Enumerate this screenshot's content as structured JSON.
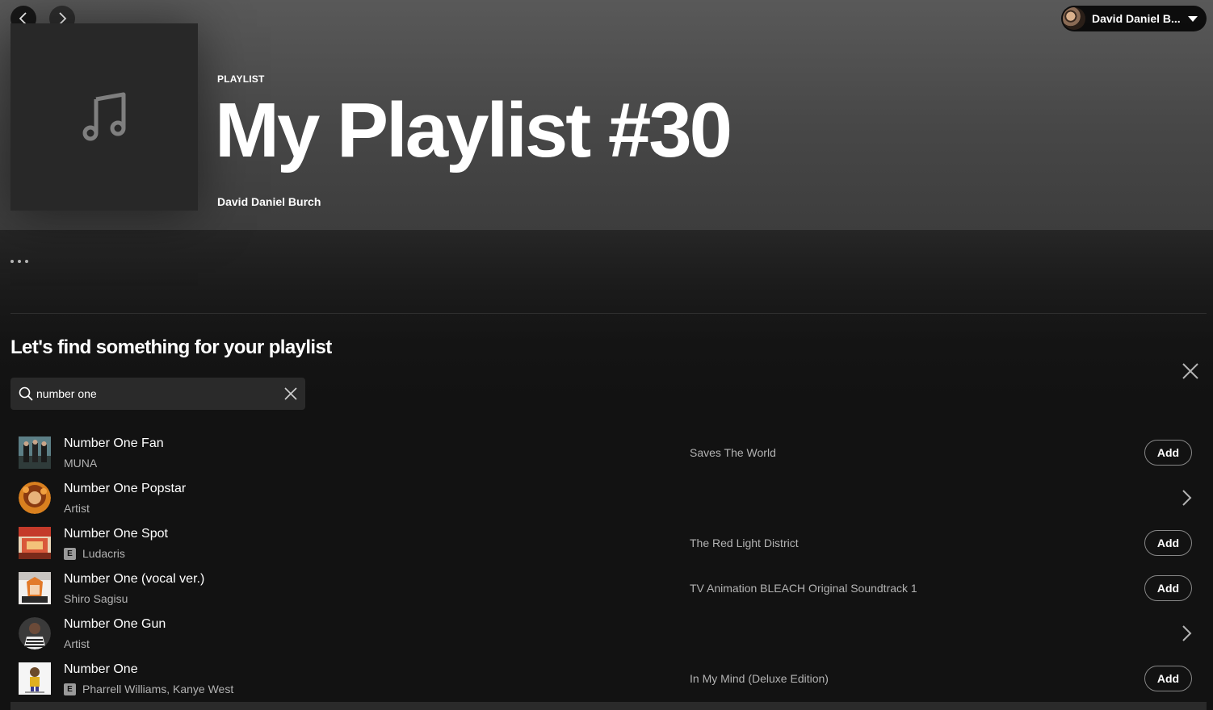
{
  "nav": {
    "back_icon": "chevron-left-icon",
    "forward_icon": "chevron-right-icon"
  },
  "user": {
    "name": "David Daniel B...",
    "caret_icon": "caret-down-icon"
  },
  "playlist": {
    "type_label": "PLAYLIST",
    "title": "My Playlist #30",
    "owner": "David Daniel Burch",
    "cover_icon": "music-note-icon"
  },
  "actions": {
    "more_icon": "more-horizontal-icon"
  },
  "find": {
    "heading": "Let's find something for your playlist",
    "close_icon": "close-icon",
    "search": {
      "value": "number one",
      "icon": "search-icon",
      "clear_icon": "clear-icon"
    }
  },
  "results": [
    {
      "title": "Number One Fan",
      "subtitle": "MUNA",
      "explicit": false,
      "album": "Saves The World",
      "kind": "track",
      "action_label": "Add"
    },
    {
      "title": "Number One Popstar",
      "subtitle": "Artist",
      "explicit": false,
      "album": "",
      "kind": "artist",
      "action_label": ""
    },
    {
      "title": "Number One Spot",
      "subtitle": "Ludacris",
      "explicit": true,
      "album": "The Red Light District",
      "kind": "track",
      "action_label": "Add"
    },
    {
      "title": "Number One (vocal ver.)",
      "subtitle": "Shiro Sagisu",
      "explicit": false,
      "album": "TV Animation BLEACH Original Soundtrack 1",
      "kind": "track",
      "action_label": "Add"
    },
    {
      "title": "Number One Gun",
      "subtitle": "Artist",
      "explicit": false,
      "album": "",
      "kind": "artist",
      "action_label": ""
    },
    {
      "title": "Number One",
      "subtitle": "Pharrell Williams, Kanye West",
      "explicit": true,
      "album": "In My Mind (Deluxe Edition)",
      "kind": "track",
      "action_label": "Add"
    }
  ],
  "explicit_label": "E",
  "colors": {
    "background": "#121212",
    "hero": "#535353",
    "text_secondary": "#b3b3b3"
  }
}
